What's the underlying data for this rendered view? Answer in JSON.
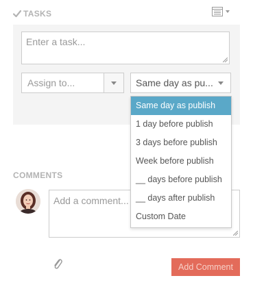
{
  "tasks": {
    "section_title": "TASKS",
    "task_input_placeholder": "Enter a task...",
    "assign_placeholder": "Assign to...",
    "schedule_selected_label": "Same day as pu..."
  },
  "dropdown": {
    "options": [
      "Same day as publish",
      "1 day before publish",
      "3 days before publish",
      "Week before publish",
      "__ days before publish",
      "__ days after publish",
      "Custom Date"
    ],
    "selected_index": 0
  },
  "comments": {
    "section_title": "COMMENTS",
    "comment_placeholder": "Add a comment...",
    "add_comment_label": "Add Comment"
  },
  "colors": {
    "accent_selected": "#5aa8c8",
    "add_comment_button": "#e36b5a",
    "panel_background": "#f4f4f4"
  },
  "icons": {
    "tasks": "check-icon",
    "list_menu": "list-icon",
    "attach": "paperclip-icon"
  }
}
